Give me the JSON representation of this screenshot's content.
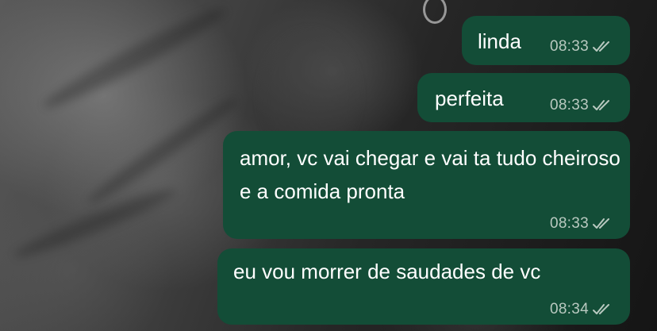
{
  "messages": [
    {
      "text": "linda",
      "time": "08:33",
      "status_icon": "double-check-icon"
    },
    {
      "text": "perfeita",
      "time": "08:33",
      "status_icon": "double-check-icon"
    },
    {
      "text": "amor, vc vai chegar e vai ta tudo cheiroso e a comida pronta",
      "time": "08:33",
      "status_icon": "double-check-icon"
    },
    {
      "text": "eu vou morrer de saudades de vc",
      "time": "08:34",
      "status_icon": "double-check-icon"
    }
  ],
  "colors": {
    "bubble_outgoing": "#134d37",
    "text": "#ffffff",
    "meta": "#b9c9c0"
  }
}
